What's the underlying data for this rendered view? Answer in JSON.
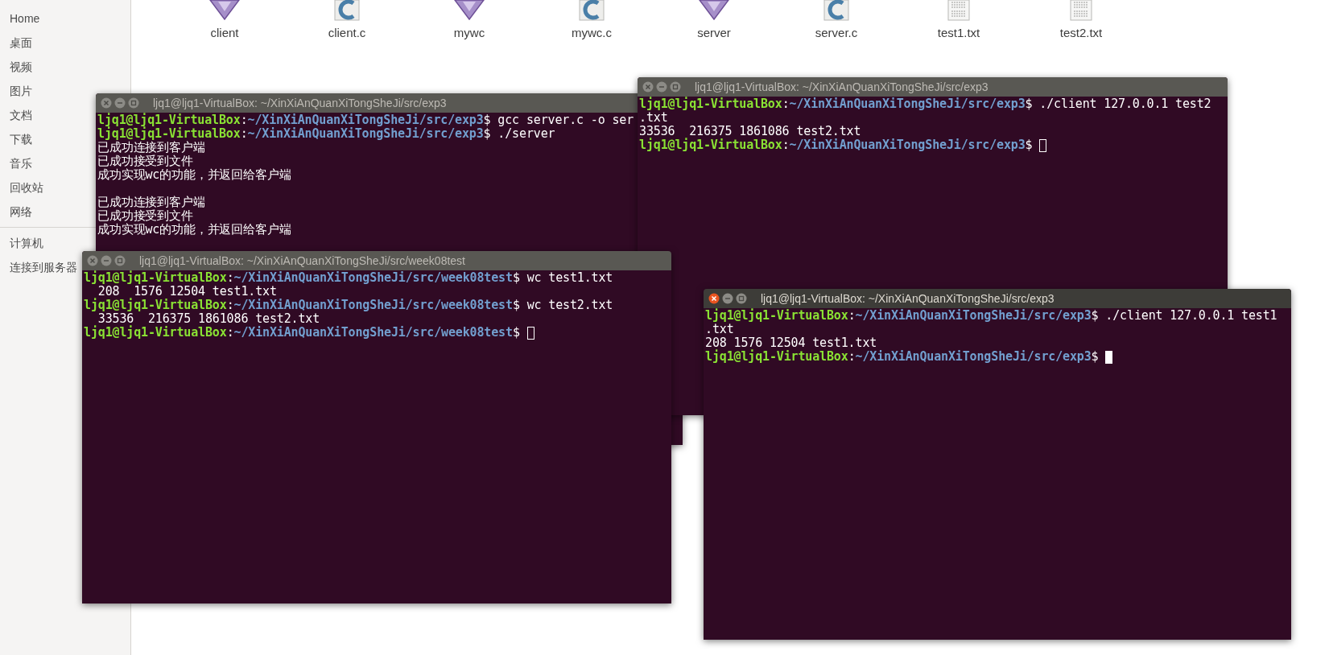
{
  "sidebar": {
    "items": [
      {
        "label": "Home"
      },
      {
        "label": "桌面"
      },
      {
        "label": "视频"
      },
      {
        "label": "图片"
      },
      {
        "label": "文档"
      },
      {
        "label": "下载"
      },
      {
        "label": "音乐"
      },
      {
        "label": "回收站"
      },
      {
        "label": "网络"
      },
      {
        "kind": "divider"
      },
      {
        "label": "计算机"
      },
      {
        "label": "连接到服务器"
      }
    ]
  },
  "files": [
    {
      "name": "client",
      "kind": "exec"
    },
    {
      "name": "client.c",
      "kind": "csource"
    },
    {
      "name": "mywc",
      "kind": "exec"
    },
    {
      "name": "mywc.c",
      "kind": "csource"
    },
    {
      "name": "server",
      "kind": "exec"
    },
    {
      "name": "server.c",
      "kind": "csource"
    },
    {
      "name": "test1.txt",
      "kind": "text"
    },
    {
      "name": "test2.txt",
      "kind": "text"
    }
  ],
  "windows": [
    {
      "title": "ljq1@ljq1-VirtualBox: ~/XinXiAnQuanXiTongSheJi/src/exp3",
      "focused": false,
      "cursor": false,
      "lines": [
        [
          {
            "kind": "user",
            "text": "ljq1@ljq1-VirtualBox"
          },
          {
            "kind": "plain",
            "text": ":"
          },
          {
            "kind": "path",
            "text": "~/XinXiAnQuanXiTongSheJi/src/exp3"
          },
          {
            "kind": "plain",
            "text": "$ gcc server.c -o ser"
          }
        ],
        [
          {
            "kind": "user",
            "text": "ljq1@ljq1-VirtualBox"
          },
          {
            "kind": "plain",
            "text": ":"
          },
          {
            "kind": "path",
            "text": "~/XinXiAnQuanXiTongSheJi/src/exp3"
          },
          {
            "kind": "plain",
            "text": "$ ./server"
          }
        ],
        [
          {
            "kind": "plain",
            "text": "已成功连接到客户端"
          }
        ],
        [
          {
            "kind": "plain",
            "text": "已成功接受到文件"
          }
        ],
        [
          {
            "kind": "plain",
            "text": "成功实现wc的功能，并返回给客户端"
          }
        ],
        [
          {
            "kind": "blank"
          }
        ],
        [
          {
            "kind": "plain",
            "text": "已成功连接到客户端"
          }
        ],
        [
          {
            "kind": "plain",
            "text": "已成功接受到文件"
          }
        ],
        [
          {
            "kind": "plain",
            "text": "成功实现wc的功能，并返回给客户端"
          }
        ]
      ]
    },
    {
      "title": "ljq1@ljq1-VirtualBox: ~/XinXiAnQuanXiTongSheJi/src/exp3",
      "focused": false,
      "cursor": true,
      "lines": [
        [
          {
            "kind": "user",
            "text": "ljq1@ljq1-VirtualBox"
          },
          {
            "kind": "plain",
            "text": ":"
          },
          {
            "kind": "path",
            "text": "~/XinXiAnQuanXiTongSheJi/src/exp3"
          },
          {
            "kind": "plain",
            "text": "$ ./client 127.0.0.1 test2"
          }
        ],
        [
          {
            "kind": "plain",
            "text": ".txt"
          }
        ],
        [
          {
            "kind": "plain",
            "text": "33536  216375 1861086 test2.txt"
          }
        ],
        [
          {
            "kind": "user",
            "text": "ljq1@ljq1-VirtualBox"
          },
          {
            "kind": "plain",
            "text": ":"
          },
          {
            "kind": "path",
            "text": "~/XinXiAnQuanXiTongSheJi/src/exp3"
          },
          {
            "kind": "plain",
            "text": "$ "
          }
        ]
      ]
    },
    {
      "title": "ljq1@ljq1-VirtualBox: ~/XinXiAnQuanXiTongSheJi/src/week08test",
      "focused": false,
      "cursor": true,
      "lines": [
        [
          {
            "kind": "user",
            "text": "ljq1@ljq1-VirtualBox"
          },
          {
            "kind": "plain",
            "text": ":"
          },
          {
            "kind": "path",
            "text": "~/XinXiAnQuanXiTongSheJi/src/week08test"
          },
          {
            "kind": "plain",
            "text": "$ wc test1.txt"
          }
        ],
        [
          {
            "kind": "plain",
            "text": "  208  1576 12504 test1.txt"
          }
        ],
        [
          {
            "kind": "user",
            "text": "ljq1@ljq1-VirtualBox"
          },
          {
            "kind": "plain",
            "text": ":"
          },
          {
            "kind": "path",
            "text": "~/XinXiAnQuanXiTongSheJi/src/week08test"
          },
          {
            "kind": "plain",
            "text": "$ wc test2.txt"
          }
        ],
        [
          {
            "kind": "plain",
            "text": "  33536  216375 1861086 test2.txt"
          }
        ],
        [
          {
            "kind": "user",
            "text": "ljq1@ljq1-VirtualBox"
          },
          {
            "kind": "plain",
            "text": ":"
          },
          {
            "kind": "path",
            "text": "~/XinXiAnQuanXiTongSheJi/src/week08test"
          },
          {
            "kind": "plain",
            "text": "$ "
          }
        ]
      ]
    },
    {
      "title": "ljq1@ljq1-VirtualBox: ~/XinXiAnQuanXiTongSheJi/src/exp3",
      "focused": true,
      "cursor": true,
      "lines": [
        [
          {
            "kind": "user",
            "text": "ljq1@ljq1-VirtualBox"
          },
          {
            "kind": "plain",
            "text": ":"
          },
          {
            "kind": "path",
            "text": "~/XinXiAnQuanXiTongSheJi/src/exp3"
          },
          {
            "kind": "plain",
            "text": "$ ./client 127.0.0.1 test1"
          }
        ],
        [
          {
            "kind": "plain",
            "text": ".txt"
          }
        ],
        [
          {
            "kind": "plain",
            "text": "208 1576 12504 test1.txt"
          }
        ],
        [
          {
            "kind": "user",
            "text": "ljq1@ljq1-VirtualBox"
          },
          {
            "kind": "plain",
            "text": ":"
          },
          {
            "kind": "path",
            "text": "~/XinXiAnQuanXiTongSheJi/src/exp3"
          },
          {
            "kind": "plain",
            "text": "$ "
          }
        ]
      ]
    }
  ]
}
